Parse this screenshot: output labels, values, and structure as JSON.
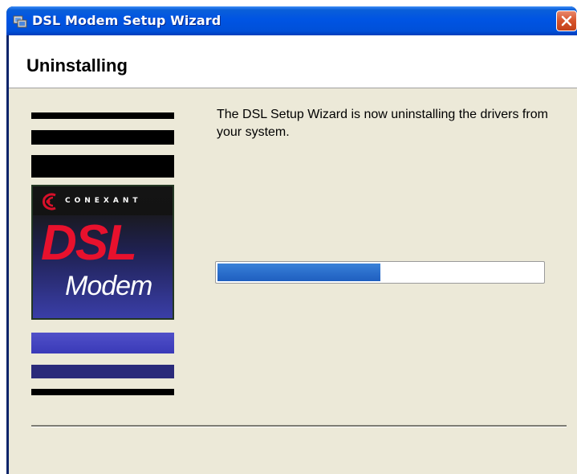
{
  "window": {
    "title": "DSL Modem Setup Wizard",
    "title_icon": "setup-wizard-icon",
    "close_icon": "close-icon"
  },
  "header": {
    "page_title": "Uninstalling"
  },
  "logo": {
    "brand": "CONEXANT",
    "line1": "DSL",
    "line2": "Modem",
    "brand_icon": "conexant-logo-icon"
  },
  "main": {
    "message": "The DSL Setup Wizard is now uninstalling the drivers from your system.",
    "progress_fraction": 0.5
  },
  "colors": {
    "titlebar": "#0054e3",
    "close_button": "#d6532b",
    "dialog_bg": "#ece9d8",
    "progress_fill": "#2b6fcc",
    "dsl_red": "#e8112d"
  }
}
